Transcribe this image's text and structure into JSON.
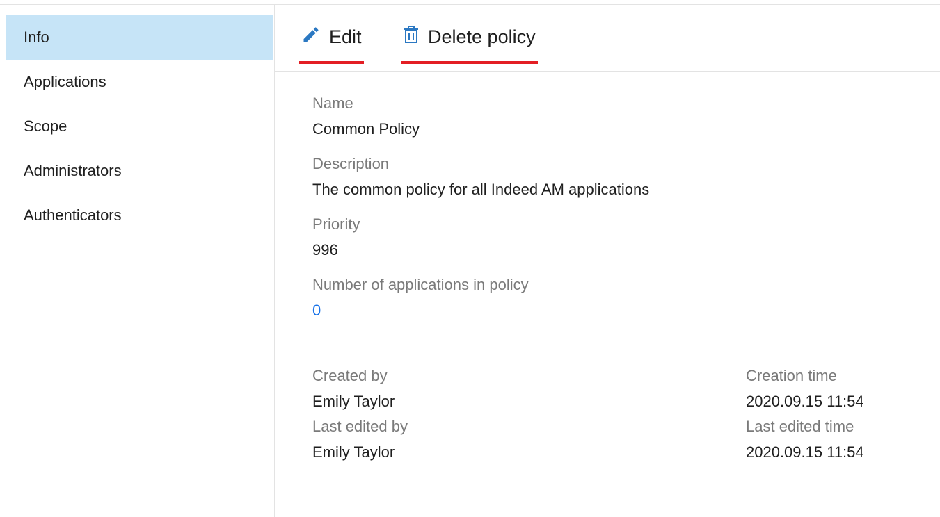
{
  "sidebar": {
    "items": [
      {
        "label": "Info",
        "active": true
      },
      {
        "label": "Applications"
      },
      {
        "label": "Scope"
      },
      {
        "label": "Administrators"
      },
      {
        "label": "Authenticators"
      }
    ]
  },
  "toolbar": {
    "edit_label": "Edit",
    "edit_icon": "pencil-icon",
    "delete_label": "Delete policy",
    "delete_icon": "trash-icon",
    "accent_color": "#e31e24",
    "icon_color": "#2b78c2"
  },
  "details": {
    "name_label": "Name",
    "name_value": "Common Policy",
    "description_label": "Description",
    "description_value": "The common policy for all Indeed AM applications",
    "priority_label": "Priority",
    "priority_value": "996",
    "apps_count_label": "Number of applications in policy",
    "apps_count_value": "0"
  },
  "meta": {
    "created_by_label": "Created by",
    "created_by_value": "Emily Taylor",
    "last_edited_by_label": "Last edited by",
    "last_edited_by_value": "Emily Taylor",
    "creation_time_label": "Creation time",
    "creation_time_value": "2020.09.15 11:54",
    "last_edited_time_label": "Last edited time",
    "last_edited_time_value": "2020.09.15 11:54"
  }
}
